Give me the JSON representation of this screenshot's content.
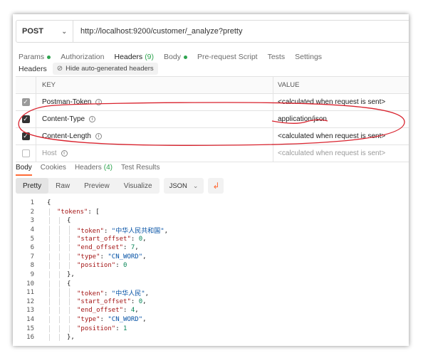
{
  "request": {
    "method": "POST",
    "url": "http://localhost:9200/customer/_analyze?pretty"
  },
  "request_tabs": [
    {
      "label": "Params",
      "badge": "dot"
    },
    {
      "label": "Authorization"
    },
    {
      "label": "Headers",
      "count": "(9)",
      "active": true
    },
    {
      "label": "Body",
      "badge": "dot"
    },
    {
      "label": "Pre-request Script"
    },
    {
      "label": "Tests"
    },
    {
      "label": "Settings"
    }
  ],
  "headers_section": {
    "label": "Headers",
    "hide_button": "Hide auto-generated headers"
  },
  "table": {
    "key_header": "KEY",
    "value_header": "VALUE",
    "rows": [
      {
        "key": "Postman-Token",
        "value": "<calculated when request is sent>",
        "state": "grey"
      },
      {
        "key": "Content-Type",
        "value": "application/json",
        "state": "on"
      },
      {
        "key": "Content-Length",
        "value": "<calculated when request is sent>",
        "state": "on"
      },
      {
        "key": "Host",
        "value": "<calculated when request is sent>",
        "state": "off"
      }
    ]
  },
  "response_tabs": [
    {
      "label": "Body",
      "active": true
    },
    {
      "label": "Cookies"
    },
    {
      "label": "Headers",
      "count": "(4)"
    },
    {
      "label": "Test Results"
    }
  ],
  "view_options": [
    "Pretty",
    "Raw",
    "Preview",
    "Visualize"
  ],
  "selected_view": "Pretty",
  "format": "JSON",
  "icons": {
    "wrap": "wrap-lines-icon",
    "info": "info-icon",
    "hide": "eye-off-icon"
  },
  "colors": {
    "accent": "#ff6c37",
    "annotation": "#d9232e",
    "status_dot": "#2ea44f"
  },
  "code_lines": [
    {
      "n": "1",
      "indent": 0,
      "parts": [
        [
          "p",
          "{"
        ]
      ]
    },
    {
      "n": "2",
      "indent": 1,
      "parts": [
        [
          "k",
          "\"tokens\""
        ],
        [
          "p",
          ": ["
        ]
      ]
    },
    {
      "n": "3",
      "indent": 2,
      "parts": [
        [
          "p",
          "{"
        ]
      ]
    },
    {
      "n": "4",
      "indent": 3,
      "parts": [
        [
          "k",
          "\"token\""
        ],
        [
          "p",
          ": "
        ],
        [
          "s",
          "\"中华人民共和国\""
        ],
        [
          "p",
          ","
        ]
      ]
    },
    {
      "n": "5",
      "indent": 3,
      "parts": [
        [
          "k",
          "\"start_offset\""
        ],
        [
          "p",
          ": "
        ],
        [
          "n",
          "0"
        ],
        [
          "p",
          ","
        ]
      ]
    },
    {
      "n": "6",
      "indent": 3,
      "parts": [
        [
          "k",
          "\"end_offset\""
        ],
        [
          "p",
          ": "
        ],
        [
          "n",
          "7"
        ],
        [
          "p",
          ","
        ]
      ]
    },
    {
      "n": "7",
      "indent": 3,
      "parts": [
        [
          "k",
          "\"type\""
        ],
        [
          "p",
          ": "
        ],
        [
          "s",
          "\"CN_WORD\""
        ],
        [
          "p",
          ","
        ]
      ]
    },
    {
      "n": "8",
      "indent": 3,
      "parts": [
        [
          "k",
          "\"position\""
        ],
        [
          "p",
          ": "
        ],
        [
          "n",
          "0"
        ]
      ]
    },
    {
      "n": "9",
      "indent": 2,
      "parts": [
        [
          "p",
          "},"
        ]
      ]
    },
    {
      "n": "10",
      "indent": 2,
      "parts": [
        [
          "p",
          "{"
        ]
      ]
    },
    {
      "n": "11",
      "indent": 3,
      "parts": [
        [
          "k",
          "\"token\""
        ],
        [
          "p",
          ": "
        ],
        [
          "s",
          "\"中华人民\""
        ],
        [
          "p",
          ","
        ]
      ]
    },
    {
      "n": "12",
      "indent": 3,
      "parts": [
        [
          "k",
          "\"start_offset\""
        ],
        [
          "p",
          ": "
        ],
        [
          "n",
          "0"
        ],
        [
          "p",
          ","
        ]
      ]
    },
    {
      "n": "13",
      "indent": 3,
      "parts": [
        [
          "k",
          "\"end_offset\""
        ],
        [
          "p",
          ": "
        ],
        [
          "n",
          "4"
        ],
        [
          "p",
          ","
        ]
      ]
    },
    {
      "n": "14",
      "indent": 3,
      "parts": [
        [
          "k",
          "\"type\""
        ],
        [
          "p",
          ": "
        ],
        [
          "s",
          "\"CN_WORD\""
        ],
        [
          "p",
          ","
        ]
      ]
    },
    {
      "n": "15",
      "indent": 3,
      "parts": [
        [
          "k",
          "\"position\""
        ],
        [
          "p",
          ": "
        ],
        [
          "n",
          "1"
        ]
      ]
    },
    {
      "n": "16",
      "indent": 2,
      "parts": [
        [
          "p",
          "},"
        ]
      ]
    }
  ]
}
